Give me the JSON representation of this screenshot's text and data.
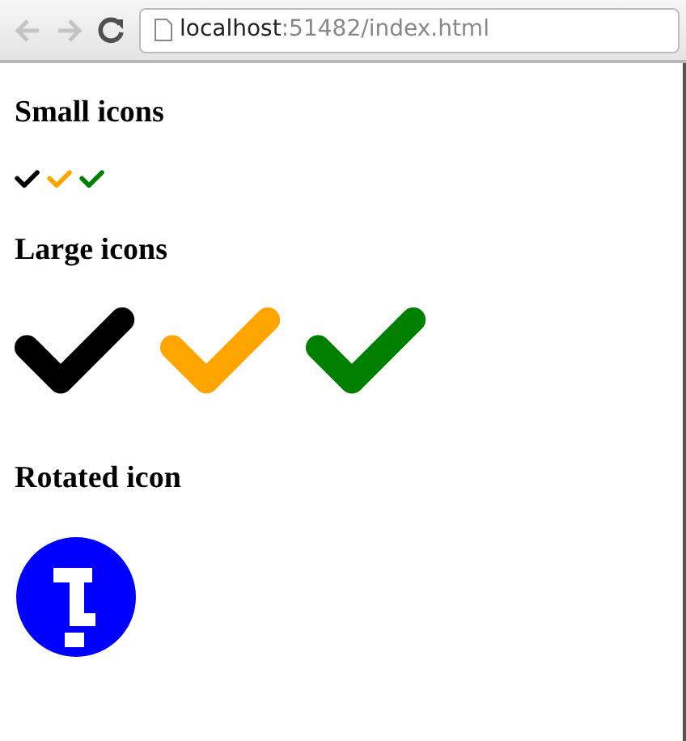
{
  "address_bar": {
    "host": "localhost",
    "path": ":51482/index.html"
  },
  "sections": [
    {
      "heading": "Small icons",
      "kind": "small",
      "icons": [
        {
          "kind": "check",
          "color": "#000000"
        },
        {
          "kind": "check",
          "color": "#ffa500"
        },
        {
          "kind": "check",
          "color": "#008000"
        }
      ]
    },
    {
      "heading": "Large icons",
      "kind": "large",
      "icons": [
        {
          "kind": "check",
          "color": "#000000"
        },
        {
          "kind": "check",
          "color": "#ffa500"
        },
        {
          "kind": "check",
          "color": "#008000"
        }
      ]
    },
    {
      "heading": "Rotated icon",
      "kind": "large",
      "icons": [
        {
          "kind": "rotated-info",
          "color": "#0000ff"
        }
      ]
    }
  ]
}
